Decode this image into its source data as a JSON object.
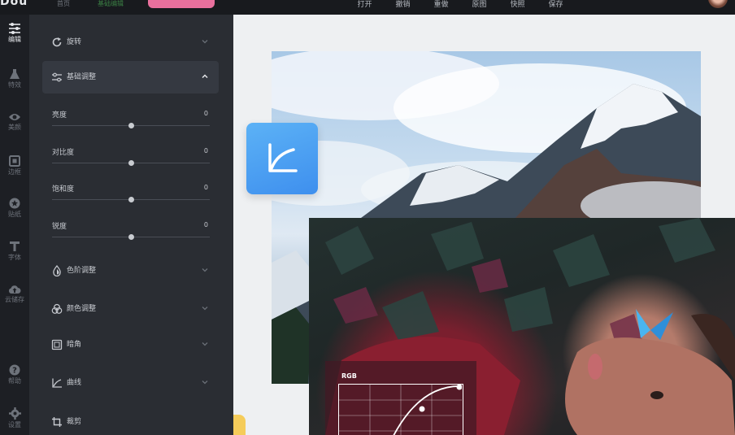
{
  "app": {
    "logo": "Dou"
  },
  "top_menu": [
    "首页",
    "基础编辑"
  ],
  "toolbar": [
    "打开",
    "撤销",
    "重做",
    "原图",
    "快照",
    "保存"
  ],
  "rail": [
    {
      "label": "编辑",
      "icon": "sliders-icon",
      "active": true
    },
    {
      "label": "特效",
      "icon": "flask-icon"
    },
    {
      "label": "美颜",
      "icon": "eye-icon"
    },
    {
      "label": "边框",
      "icon": "frame-icon"
    },
    {
      "label": "贴纸",
      "icon": "sticker-icon"
    },
    {
      "label": "字体",
      "icon": "text-icon"
    },
    {
      "label": "云储存",
      "icon": "cloud-upload-icon"
    },
    {
      "label": "帮助",
      "icon": "help-icon"
    },
    {
      "label": "设置",
      "icon": "gear-icon"
    }
  ],
  "panel": {
    "sections": [
      {
        "label": "旋转",
        "icon": "rotate-icon"
      },
      {
        "label": "基础调整",
        "icon": "adjust-icon",
        "open": true
      },
      {
        "label": "色阶调整",
        "icon": "drop-icon"
      },
      {
        "label": "颜色调整",
        "icon": "color-circles-icon"
      },
      {
        "label": "暗角",
        "icon": "vignette-icon"
      },
      {
        "label": "曲线",
        "icon": "curve-icon"
      },
      {
        "label": "裁剪",
        "icon": "crop-icon"
      }
    ],
    "sliders": [
      {
        "label": "亮度",
        "value": "0",
        "level": 0.5
      },
      {
        "label": "对比度",
        "value": "0",
        "level": 0.5
      },
      {
        "label": "饱和度",
        "value": "0",
        "level": 0.5
      },
      {
        "label": "锐度",
        "value": "0",
        "level": 0.5
      }
    ]
  },
  "canvas": {
    "curve_label": "RGB"
  },
  "colors": {
    "accent_blue": "#4a9ff3",
    "panel_bg": "#2a2d33",
    "rail_bg": "#1d1f24",
    "pink": "#e9709d",
    "yellow": "#f5cc5a"
  }
}
